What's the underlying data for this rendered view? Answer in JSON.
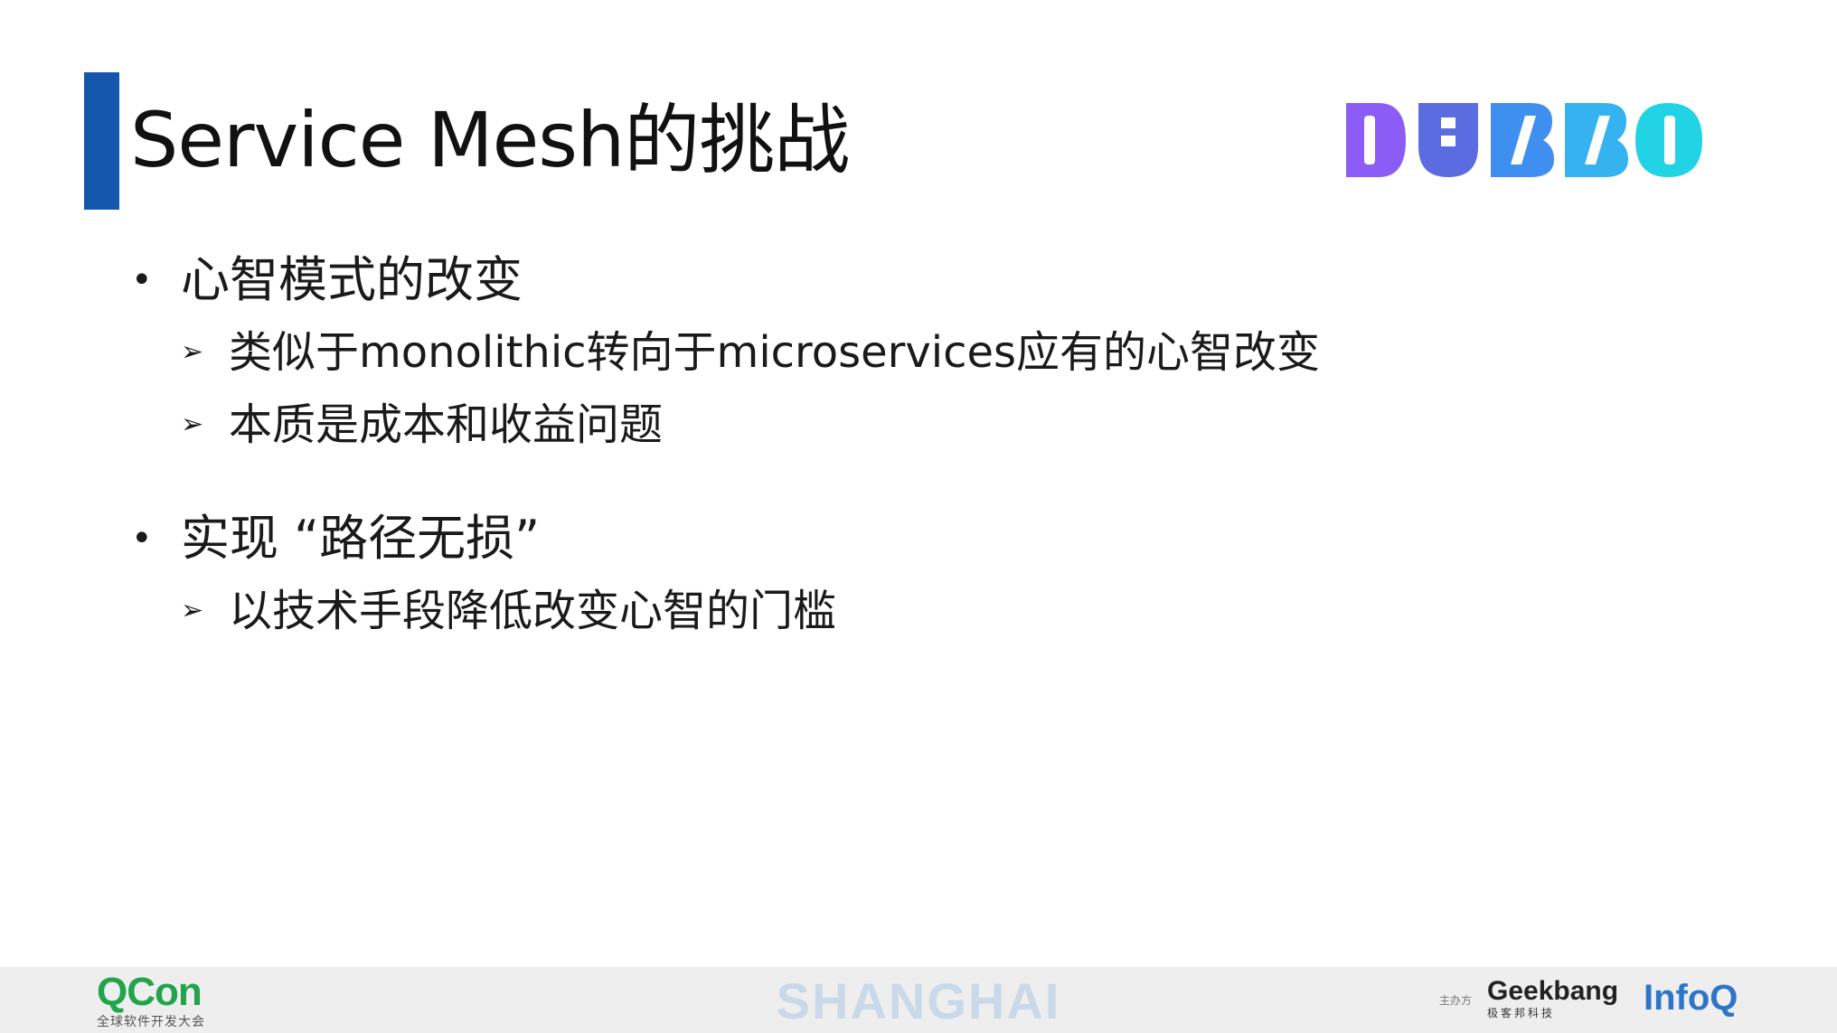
{
  "slide": {
    "title": "Service Mesh的挑战",
    "bullets": [
      {
        "text": "心智模式的改变",
        "subitems": [
          "类似于monolithic转向于microservices应有的心智改变",
          "本质是成本和收益问题"
        ]
      },
      {
        "text": "实现 “路径无损”",
        "subitems": [
          "以技术手段降低改变心智的门槛"
        ]
      }
    ],
    "bullet_symbol": "•",
    "subbullet_symbol": "➢"
  },
  "logo": {
    "letters": [
      "D",
      "U",
      "B",
      "B",
      "O"
    ],
    "colors": [
      "#8b5cf6",
      "#5b6be0",
      "#3f8ff0",
      "#35b3f0",
      "#22d3e6"
    ]
  },
  "footer": {
    "qcon": "QCon",
    "qcon_sub": "全球软件开发大会",
    "city": "SHANGHAI",
    "organizer_label": "主办方",
    "geekbang": "Geekbang",
    "geekbang_sub": "极客邦科技",
    "infoq": "InfoQ"
  }
}
